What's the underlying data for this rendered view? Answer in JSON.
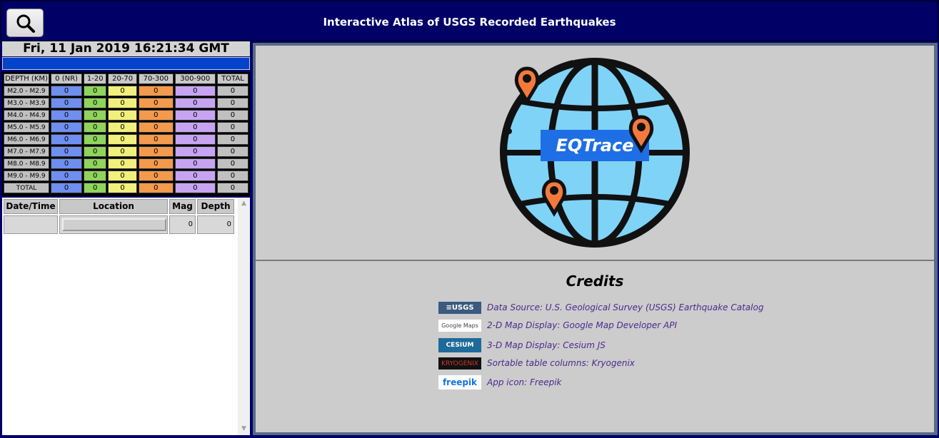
{
  "header": {
    "title": "Interactive Atlas of USGS Recorded Earthquakes",
    "search_icon": "search-icon",
    "bg_color": "#000066"
  },
  "status": {
    "datetime": "Fri, 11 Jan 2019 16:21:34 GMT",
    "progress": 1.0
  },
  "summary": {
    "headers": [
      "DEPTH (KM)",
      "0 (NR)",
      "1-20",
      "20-70",
      "70-300",
      "300-900",
      "TOTAL"
    ],
    "rows": [
      {
        "label": "M2.0 - M2.9",
        "values": [
          "0",
          "0",
          "0",
          "0",
          "0",
          "0"
        ]
      },
      {
        "label": "M3.0 - M3.9",
        "values": [
          "0",
          "0",
          "0",
          "0",
          "0",
          "0"
        ]
      },
      {
        "label": "M4.0 - M4.9",
        "values": [
          "0",
          "0",
          "0",
          "0",
          "0",
          "0"
        ]
      },
      {
        "label": "M5.0 - M5.9",
        "values": [
          "0",
          "0",
          "0",
          "0",
          "0",
          "0"
        ]
      },
      {
        "label": "M6.0 - M6.9",
        "values": [
          "0",
          "0",
          "0",
          "0",
          "0",
          "0"
        ]
      },
      {
        "label": "M7.0 - M7.9",
        "values": [
          "0",
          "0",
          "0",
          "0",
          "0",
          "0"
        ]
      },
      {
        "label": "M8.0 - M8.9",
        "values": [
          "0",
          "0",
          "0",
          "0",
          "0",
          "0"
        ]
      },
      {
        "label": "M9.0 - M9.9",
        "values": [
          "0",
          "0",
          "0",
          "0",
          "0",
          "0"
        ]
      },
      {
        "label": "TOTAL",
        "values": [
          "0",
          "0",
          "0",
          "0",
          "0",
          "0"
        ]
      }
    ],
    "colors": [
      "#6f8ff0",
      "#8fd45c",
      "#f0f07a",
      "#f39a4c",
      "#c7a4f2",
      "#c0c0c0"
    ]
  },
  "quake_list": {
    "columns": [
      "Date/Time",
      "Location",
      "Mag",
      "Depth"
    ],
    "rows": [
      {
        "datetime": "",
        "location": "",
        "mag": "0",
        "depth": "0"
      }
    ]
  },
  "logo": {
    "text": "EQTrace",
    "icon": "globe-with-map-pins-icon"
  },
  "credits": {
    "title": "Credits",
    "items": [
      {
        "logo_text": "≡USGS",
        "icon": "usgs-logo",
        "text": "Data Source: U.S. Geological Survey (USGS) Earthquake Catalog"
      },
      {
        "logo_text": "Google Maps",
        "icon": "google-maps-logo",
        "text": "2-D Map Display: Google Map Developer API"
      },
      {
        "logo_text": "CESIUM",
        "icon": "cesium-logo",
        "text": "3-D Map Display: Cesium JS"
      },
      {
        "logo_text": "KRYOGENIX",
        "icon": "kryogenix-logo",
        "text": "Sortable table columns: Kryogenix"
      },
      {
        "logo_text": "freepik",
        "icon": "freepik-logo",
        "text": "App icon: Freepik"
      }
    ]
  }
}
